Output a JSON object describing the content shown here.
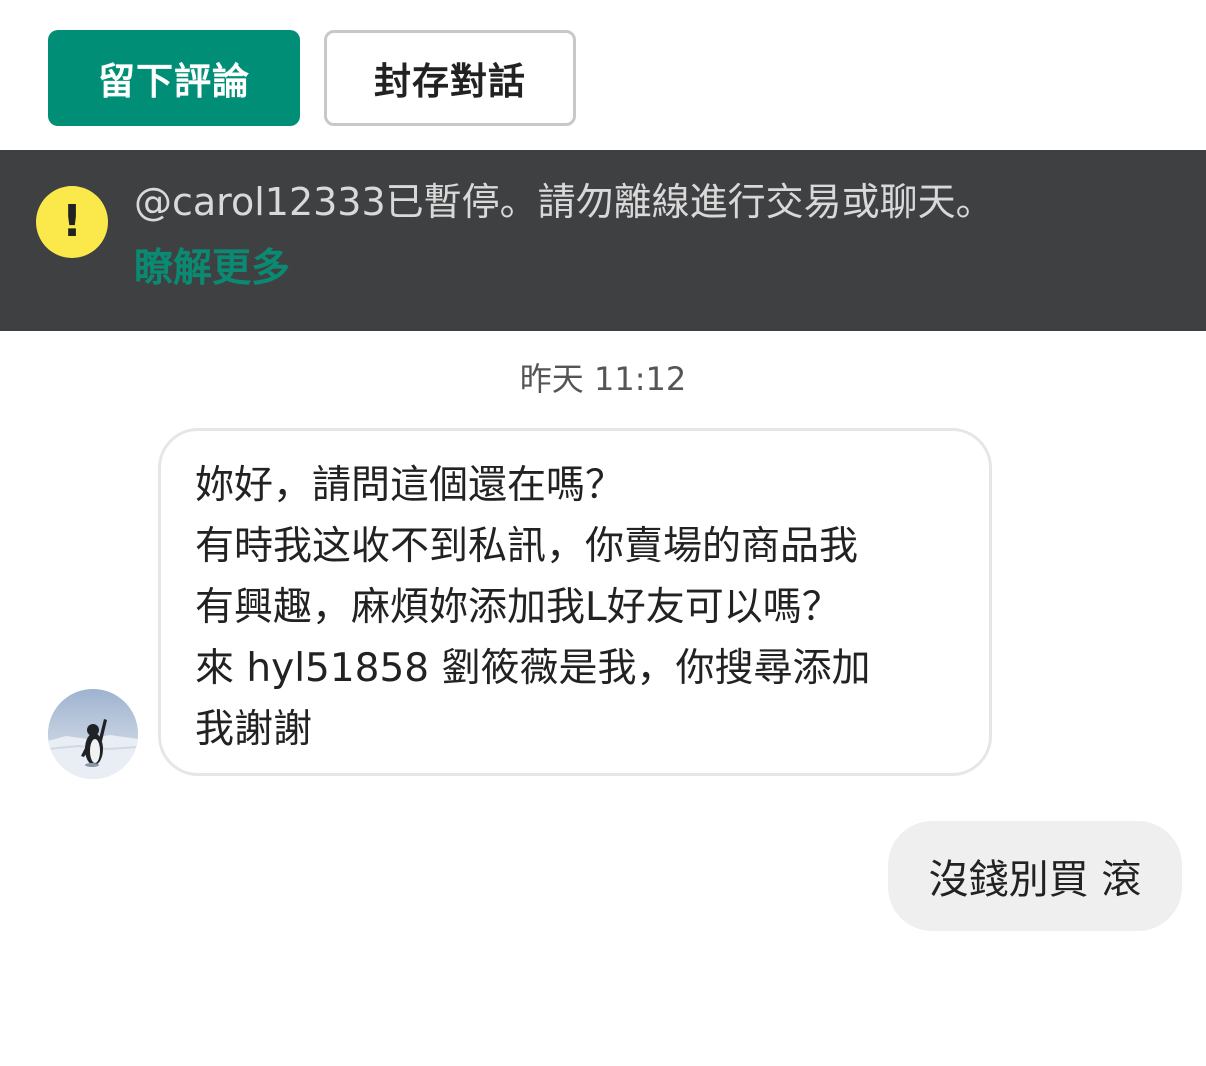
{
  "actions": {
    "review_label": "留下評論",
    "archive_label": "封存對話"
  },
  "banner": {
    "icon": "exclamation-icon",
    "icon_glyph": "!",
    "message": "@carol12333已暫停。請勿離線進行交易或聊天。",
    "link_label": "瞭解更多"
  },
  "chat": {
    "timestamp": "昨天 11:12",
    "incoming": {
      "avatar": "penguin-avatar",
      "lines": [
        "妳好，請問這個還在嗎？",
        "有時我这收不到私訊，你賣場的商品我",
        "有興趣，麻煩妳添加我L好友可以嗎？",
        "來 hyl51858 劉筱薇是我，你搜尋添加",
        "我謝謝"
      ]
    },
    "outgoing": {
      "text": "沒錢別買 滾"
    }
  },
  "colors": {
    "primary": "#008f76",
    "banner_bg": "#3f4042",
    "warning": "#fbe94b",
    "link": "#0a8a72",
    "outgoing_bubble": "#efefef"
  }
}
